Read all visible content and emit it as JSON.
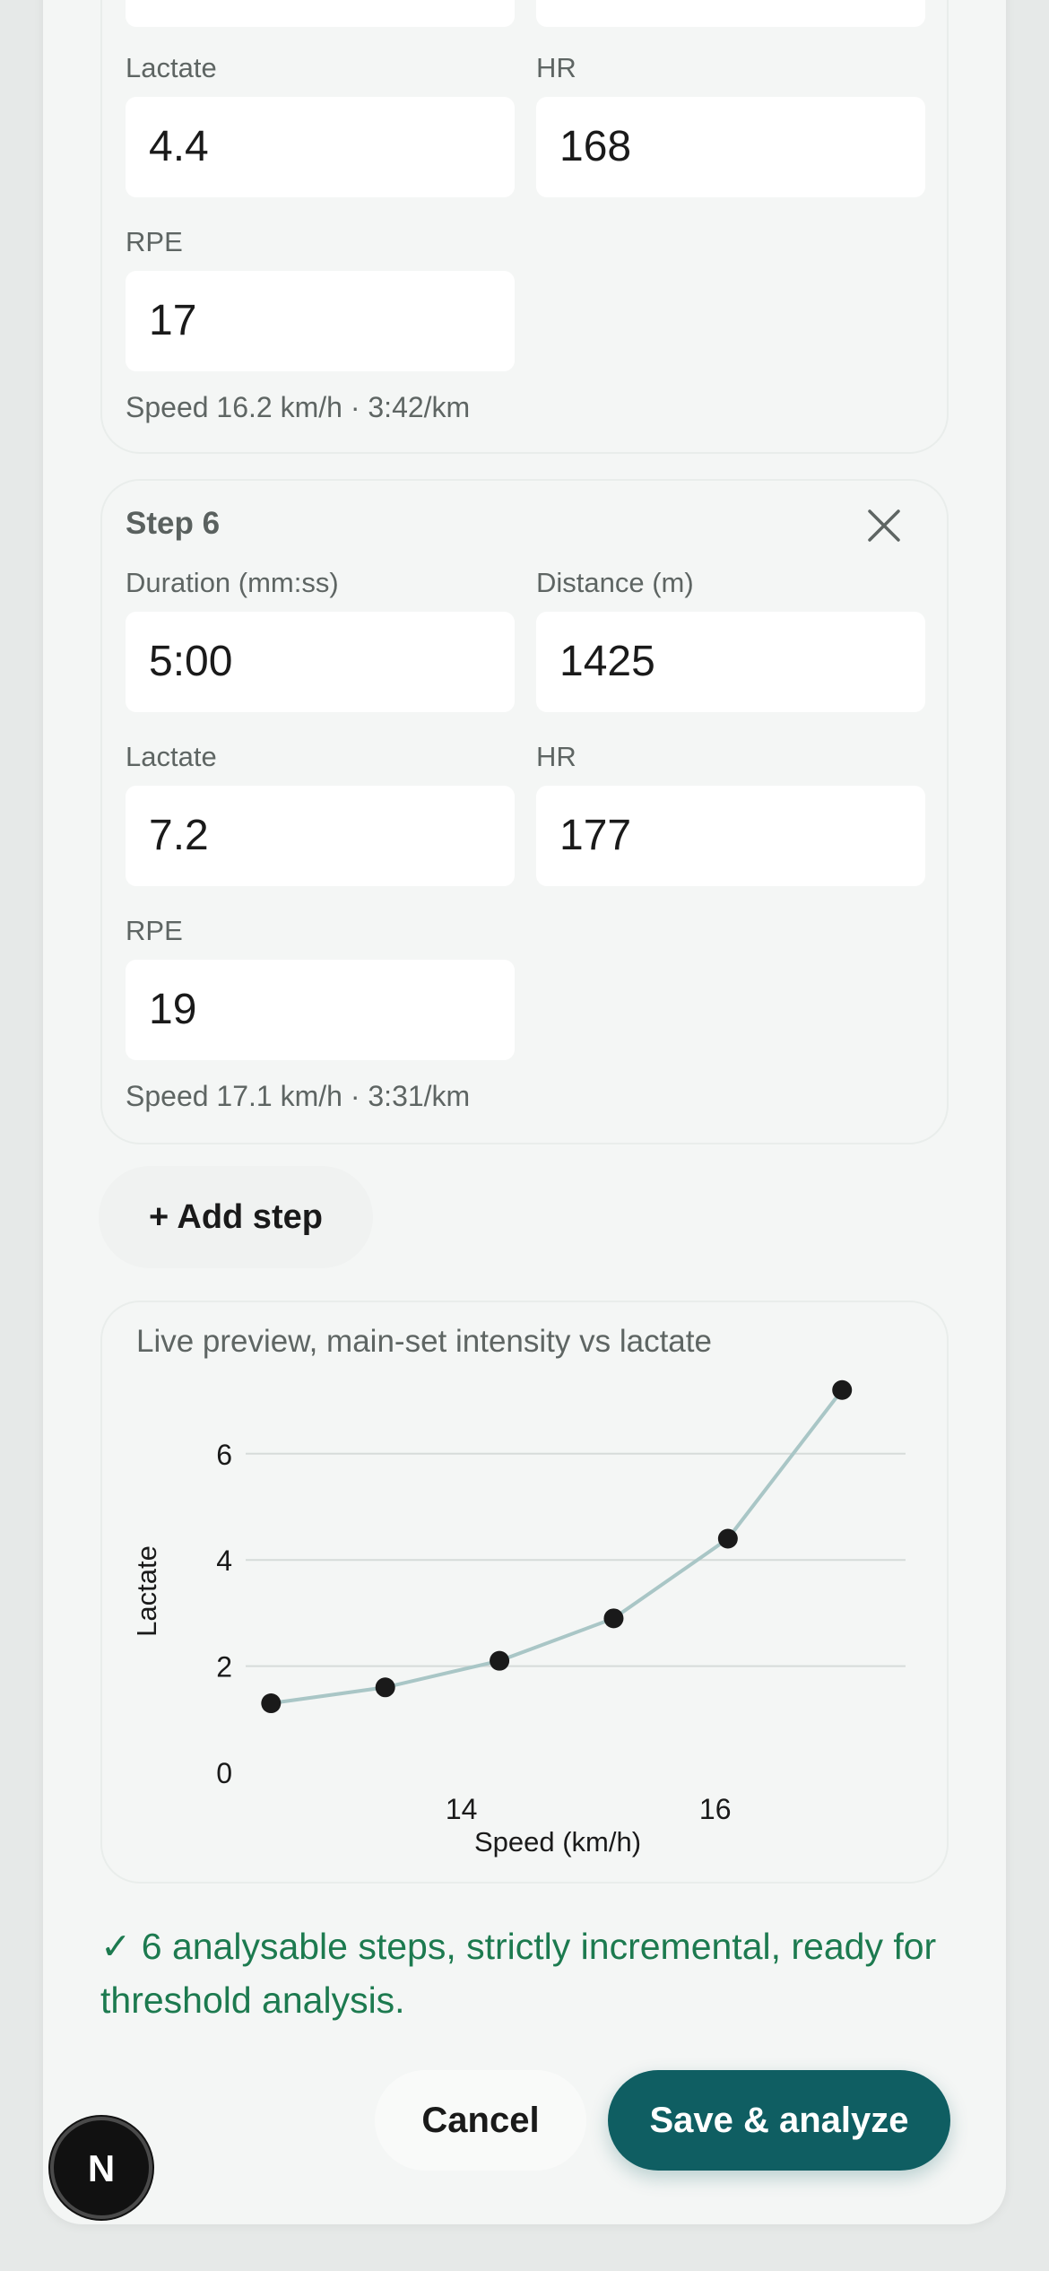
{
  "step5": {
    "lactate_label": "Lactate",
    "lactate_value": "4.4",
    "hr_label": "HR",
    "hr_value": "168",
    "rpe_label": "RPE",
    "rpe_value": "17",
    "speed_text": "Speed 16.2 km/h · 3:42/km"
  },
  "step6": {
    "title": "Step 6",
    "duration_label": "Duration (mm:ss)",
    "duration_value": "5:00",
    "distance_label": "Distance (m)",
    "distance_value": "1425",
    "lactate_label": "Lactate",
    "lactate_value": "7.2",
    "hr_label": "HR",
    "hr_value": "177",
    "rpe_label": "RPE",
    "rpe_value": "19",
    "speed_text": "Speed 17.1 km/h · 3:31/km"
  },
  "add_step_label": "+ Add step",
  "chart_title": "Live preview, main-set intensity vs lactate",
  "chart_data": {
    "type": "line",
    "title": "",
    "xlabel": "Speed (km/h)",
    "ylabel": "Lactate",
    "x": [
      12.5,
      13.4,
      14.3,
      15.2,
      16.1,
      17.0
    ],
    "y": [
      1.3,
      1.6,
      2.1,
      2.9,
      4.4,
      7.2
    ],
    "x_ticks": [
      "14",
      "16"
    ],
    "x_tick_values": [
      14,
      16
    ],
    "y_ticks": [
      "0",
      "2",
      "4",
      "6"
    ],
    "y_tick_values": [
      0,
      2,
      4,
      6
    ],
    "xlim": [
      12.3,
      17.5
    ],
    "ylim": [
      0,
      7.5
    ],
    "grid": "horizontal",
    "line_color": "#a9c6c6",
    "point_color": "#1a1a1a"
  },
  "status_text": "✓ 6 analysable steps, strictly incremental, ready for threshold analysis.",
  "buttons": {
    "cancel": "Cancel",
    "save": "Save & analyze"
  },
  "badge_letter": "N",
  "colors": {
    "accent": "#0f5e62",
    "success": "#1c7a4f"
  }
}
